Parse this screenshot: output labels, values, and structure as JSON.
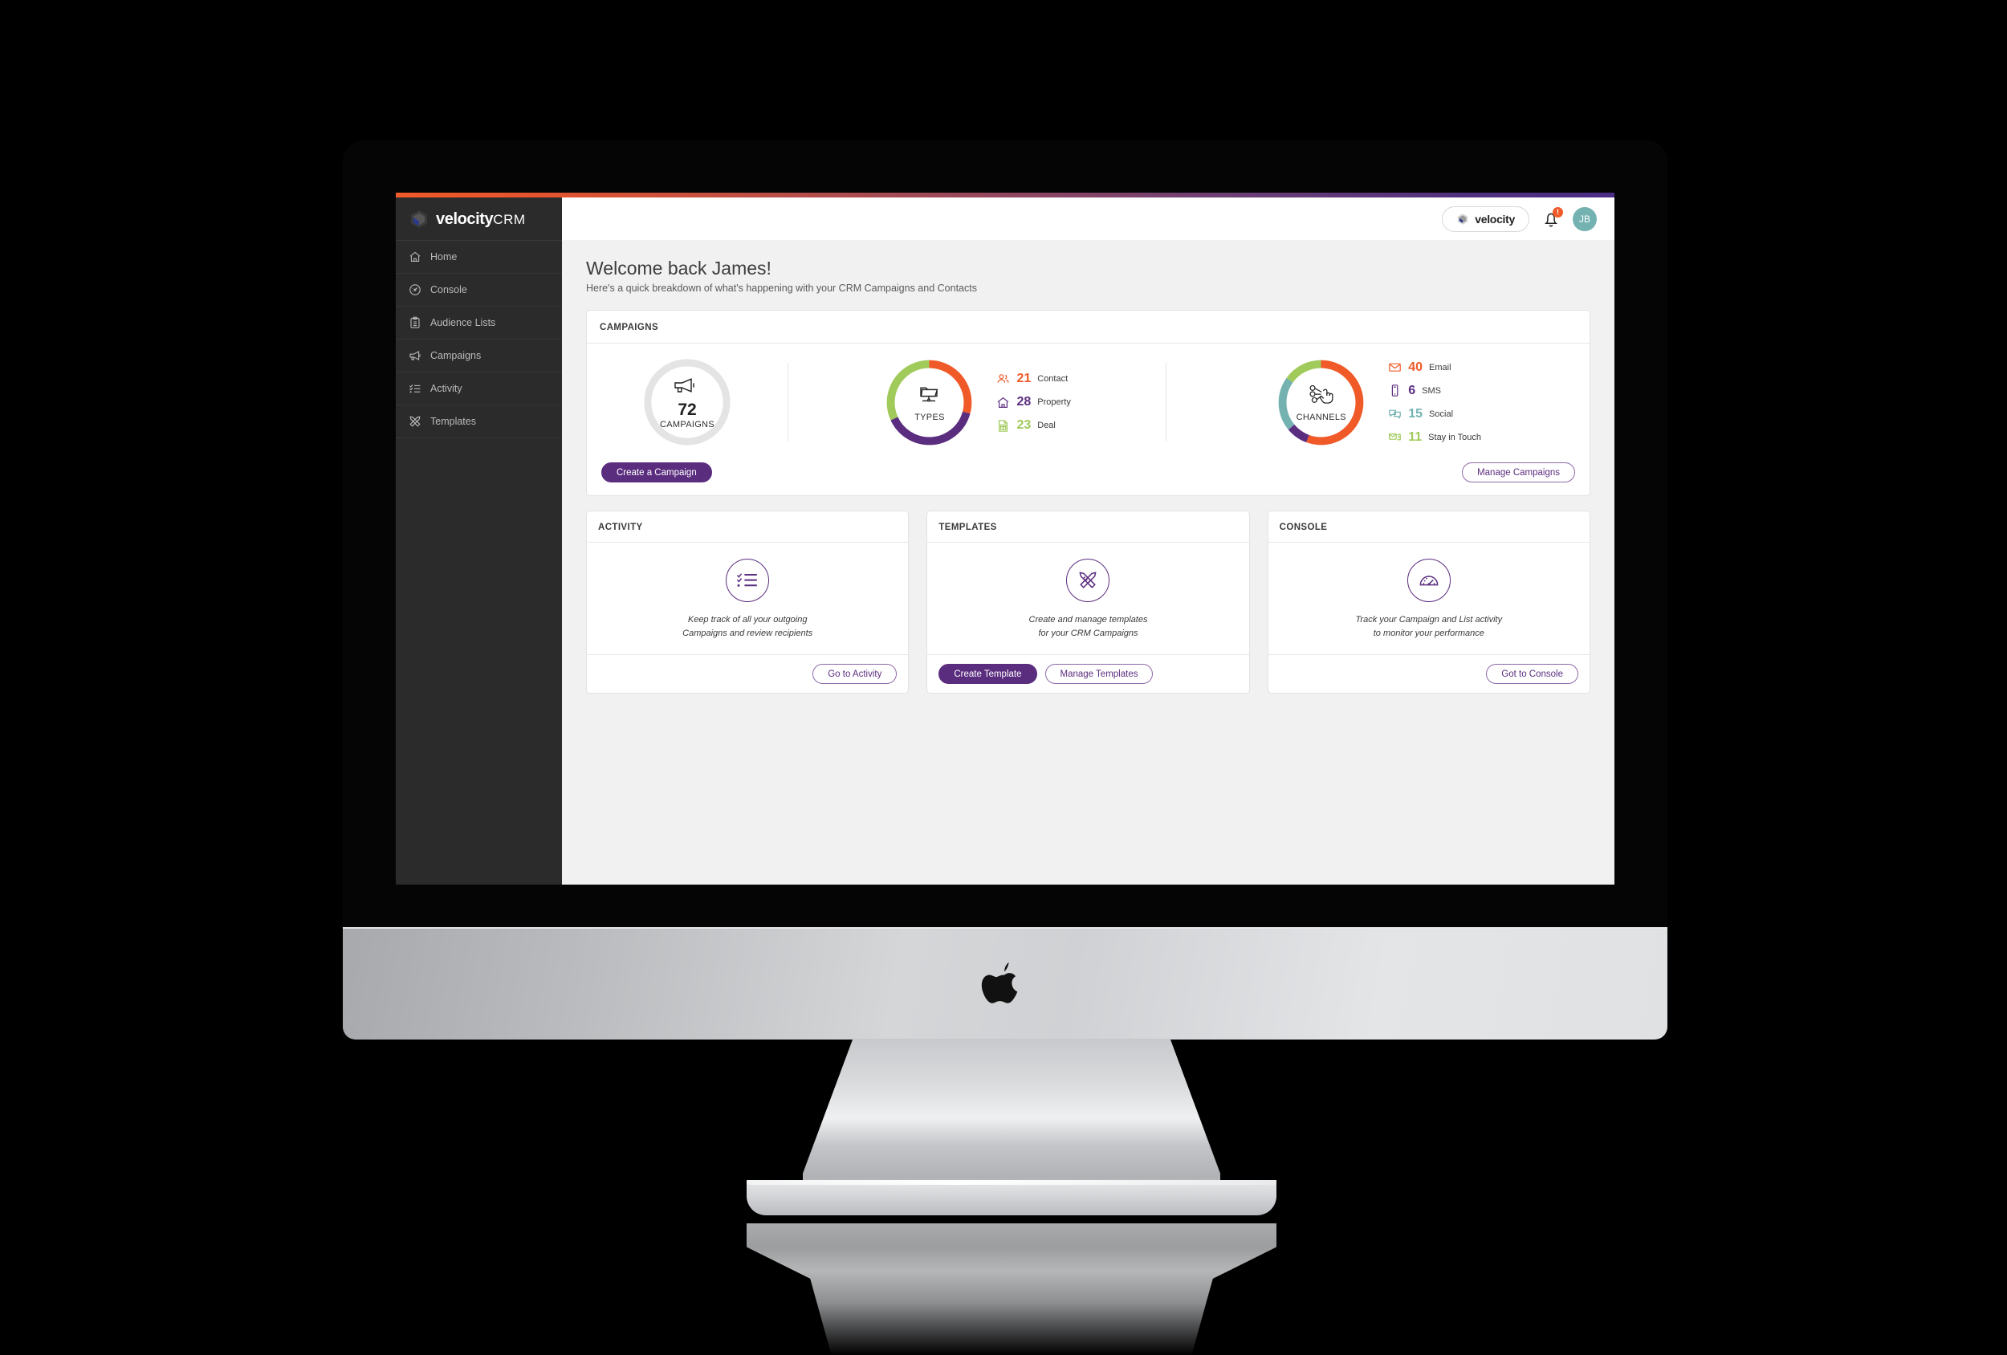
{
  "brand": {
    "name": "velocity",
    "suffix": "CRM",
    "logo_icon": "velocity-hex-logo-icon"
  },
  "sidebar": {
    "items": [
      {
        "label": "Home",
        "icon": "home-icon"
      },
      {
        "label": "Console",
        "icon": "gauge-icon"
      },
      {
        "label": "Audience Lists",
        "icon": "clipboard-list-icon"
      },
      {
        "label": "Campaigns",
        "icon": "megaphone-icon"
      },
      {
        "label": "Activity",
        "icon": "checklist-icon"
      },
      {
        "label": "Templates",
        "icon": "pencil-ruler-icon"
      }
    ]
  },
  "topbar": {
    "workspace_pill": "velocity",
    "workspace_icon": "velocity-hex-logo-icon",
    "bell_icon": "bell-icon",
    "bell_badge": "!",
    "avatar_initials": "JB"
  },
  "page": {
    "greeting": "Welcome back James!",
    "subtitle": "Here's a quick breakdown of what's happening with your CRM Campaigns and Contacts"
  },
  "campaigns_card": {
    "title": "CAMPAIGNS",
    "total": {
      "value": "72",
      "label": "CAMPAIGNS",
      "icon": "megaphone-icon"
    },
    "types": {
      "label": "TYPES",
      "icon": "folder-network-icon"
    },
    "channels": {
      "label": "CHANNELS",
      "icon": "share-hand-icon"
    },
    "create_button": "Create a Campaign",
    "manage_button": "Manage Campaigns"
  },
  "tiles": [
    {
      "title": "ACTIVITY",
      "icon": "checklist-circle-icon",
      "description_line1": "Keep track of all your outgoing",
      "description_line2": "Campaigns and review recipients",
      "primary_button": null,
      "secondary_button": "Go to Activity"
    },
    {
      "title": "TEMPLATES",
      "icon": "pencil-ruler-circle-icon",
      "description_line1": "Create and manage templates",
      "description_line2": "for your CRM Campaigns",
      "primary_button": "Create Template",
      "secondary_button": "Manage Templates"
    },
    {
      "title": "CONSOLE",
      "icon": "gauge-circle-icon",
      "description_line1": "Track your Campaign and List activity",
      "description_line2": "to monitor your performance",
      "primary_button": null,
      "secondary_button": "Got to Console"
    }
  ],
  "colors": {
    "orange": "#ef5a28",
    "purple": "#5b2d7f",
    "green": "#a0ca5a",
    "teal": "#74b2b2",
    "sidebar_bg": "#2b2b2b",
    "page_bg": "#f1f1f1"
  },
  "chart_data": [
    {
      "type": "pie",
      "title": "TYPES",
      "center_label": "TYPES",
      "categories": [
        "Contact",
        "Property",
        "Deal"
      ],
      "values": [
        21,
        28,
        23
      ],
      "colors": [
        "#ef5a28",
        "#5b2d7f",
        "#a0ca5a"
      ],
      "total": 72,
      "legend_position": "right",
      "donut": true
    },
    {
      "type": "pie",
      "title": "CHANNELS",
      "center_label": "CHANNELS",
      "categories": [
        "Email",
        "SMS",
        "Social",
        "Stay in Touch"
      ],
      "values": [
        40,
        6,
        15,
        11
      ],
      "colors": [
        "#ef5a28",
        "#5b2d7f",
        "#74b2b2",
        "#a0ca5a"
      ],
      "total": 72,
      "legend_position": "right",
      "donut": true
    },
    {
      "type": "pie",
      "title": "CAMPAIGNS",
      "center_label": "CAMPAIGNS",
      "categories": [
        "Campaigns"
      ],
      "values": [
        72
      ],
      "colors": [
        "#e2e2e2"
      ],
      "total": 72,
      "donut": true
    }
  ],
  "type_stats": [
    {
      "value": "21",
      "label": "Contact",
      "color": "#ef5a28",
      "icon": "people-icon"
    },
    {
      "value": "28",
      "label": "Property",
      "color": "#5b2d7f",
      "icon": "house-icon"
    },
    {
      "value": "23",
      "label": "Deal",
      "color": "#a0ca5a",
      "icon": "document-grid-icon"
    }
  ],
  "channel_stats": [
    {
      "value": "40",
      "label": "Email",
      "color": "#ef5a28",
      "icon": "envelope-icon"
    },
    {
      "value": "6",
      "label": "SMS",
      "color": "#5b2d7f",
      "icon": "phone-icon"
    },
    {
      "value": "15",
      "label": "Social",
      "color": "#74b2b2",
      "icon": "chat-bubbles-icon"
    },
    {
      "value": "11",
      "label": "Stay in Touch",
      "color": "#a0ca5a",
      "icon": "mail-stack-icon"
    }
  ]
}
